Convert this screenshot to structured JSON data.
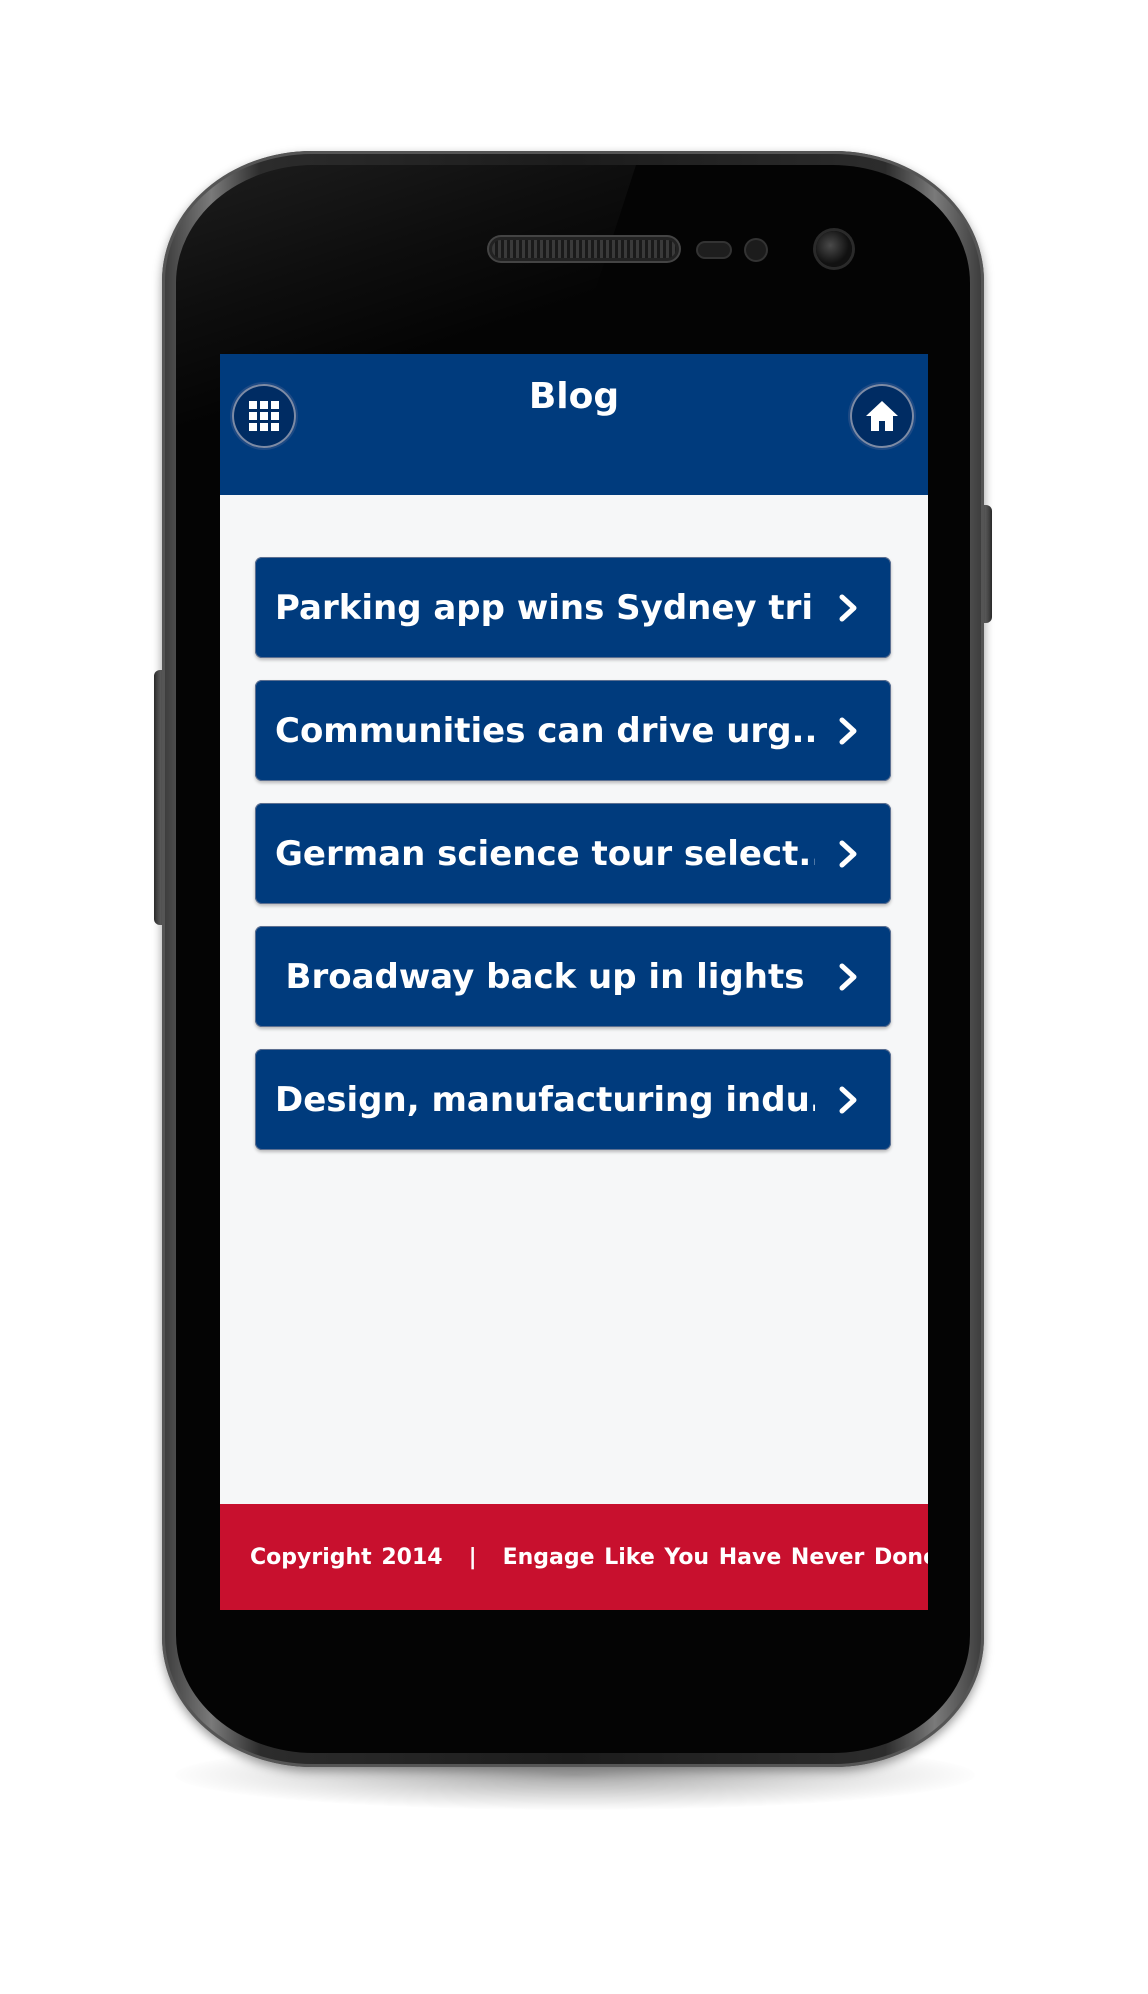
{
  "header": {
    "title": "Blog",
    "menu_icon": "grid-icon",
    "home_icon": "home-icon"
  },
  "posts": [
    {
      "title": "Parking app wins Sydney tri..."
    },
    {
      "title": "Communities can drive urg..."
    },
    {
      "title": "German science tour select..."
    },
    {
      "title": "Broadway back up in lights"
    },
    {
      "title": "Design, manufacturing indu..."
    }
  ],
  "footer": {
    "copyright": "Copyright 2014",
    "separator": "|",
    "tagline": "Engage Like You Have Never Done Before"
  },
  "colors": {
    "header_bg": "#003b7d",
    "item_bg": "#003b7d",
    "footer_bg": "#c8102e",
    "screen_bg": "#f6f7f8"
  }
}
